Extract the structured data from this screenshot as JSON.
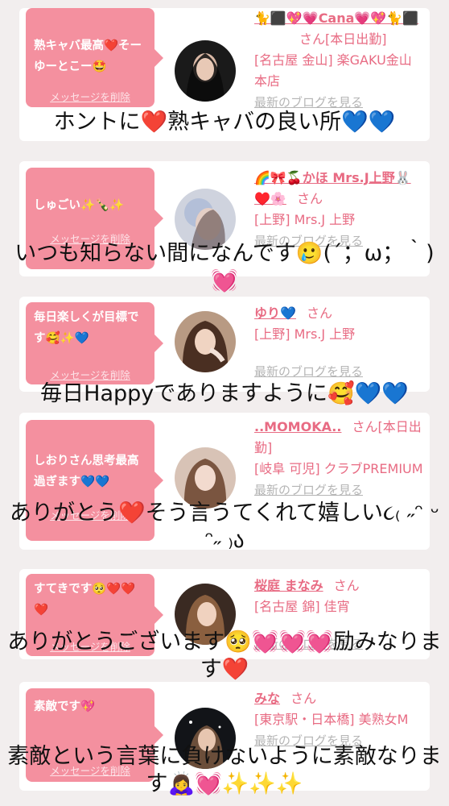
{
  "cards": [
    {
      "bubble_text": "熟キャバ最高❤️そーゆーとこー🤩",
      "delete_label": "メッセージを削除",
      "name": "🐈⬛💖💗Cana💗💖🐈⬛",
      "san": "さん[本日出勤]",
      "location": "[名古屋 金山] 楽GAKU金山本店",
      "blog_label": "最新のブログを見る",
      "caption": "ホントに❤️熟キャバの良い所💙💙"
    },
    {
      "bubble_text": "しゅごい✨🍾✨",
      "delete_label": "メッセージを削除",
      "name": "🌈🎀🍒かほ Mrs.J上野🐰♥️🌸",
      "san": "さん",
      "location": "[上野] Mrs.J 上野",
      "blog_label": "最新のブログを見る",
      "caption": "いつも知らない間になんです🥲(´；ω；｀)💓"
    },
    {
      "bubble_text": "毎日楽しくが目標です🥰✨💙",
      "delete_label": "メッセージを削除",
      "name": "ゆり💙",
      "san": "さん",
      "location": "[上野] Mrs.J 上野",
      "blog_label": "最新のブログを見る",
      "caption": "毎日Happyでありますように🥰💙💙"
    },
    {
      "bubble_text": "しおりさん思考最高過ぎます💙💙",
      "delete_label": "メッセージを削除",
      "name": "..MOMOKA..",
      "san": "さん[本日出勤]",
      "location": "[岐阜 可児] クラブPREMIUM",
      "blog_label": "最新のブログを見る",
      "caption": "ありがとう❤️そう言うてくれて嬉しい૮₍ ˶ᵔ ᵕ ᵔ˶ ₎ა"
    },
    {
      "bubble_text": "すてきです🥺❤️❤️❤️",
      "delete_label": "メッセージを削除",
      "name": "桜庭 まなみ",
      "san": "さん",
      "location": "[名古屋 錦] 佳宵",
      "blog_label": "最新のブログを見る",
      "caption": "ありがとうございます🥺💓💓💓励みなります❤️"
    },
    {
      "bubble_text": "素敵です💖",
      "delete_label": "メッセージを削除",
      "name": "みな",
      "san": "さん",
      "location": "[東京駅・日本橋] 美熟女M",
      "blog_label": "最新のブログを見る",
      "caption": "素敵という言葉に負けないように素敵なります🙇‍♀️💓✨✨✨"
    }
  ],
  "colors": {
    "bubble": "#f4909f",
    "accent_text": "#e86b83",
    "blog_link": "#b5b5b5",
    "background": "#f2eeee"
  }
}
